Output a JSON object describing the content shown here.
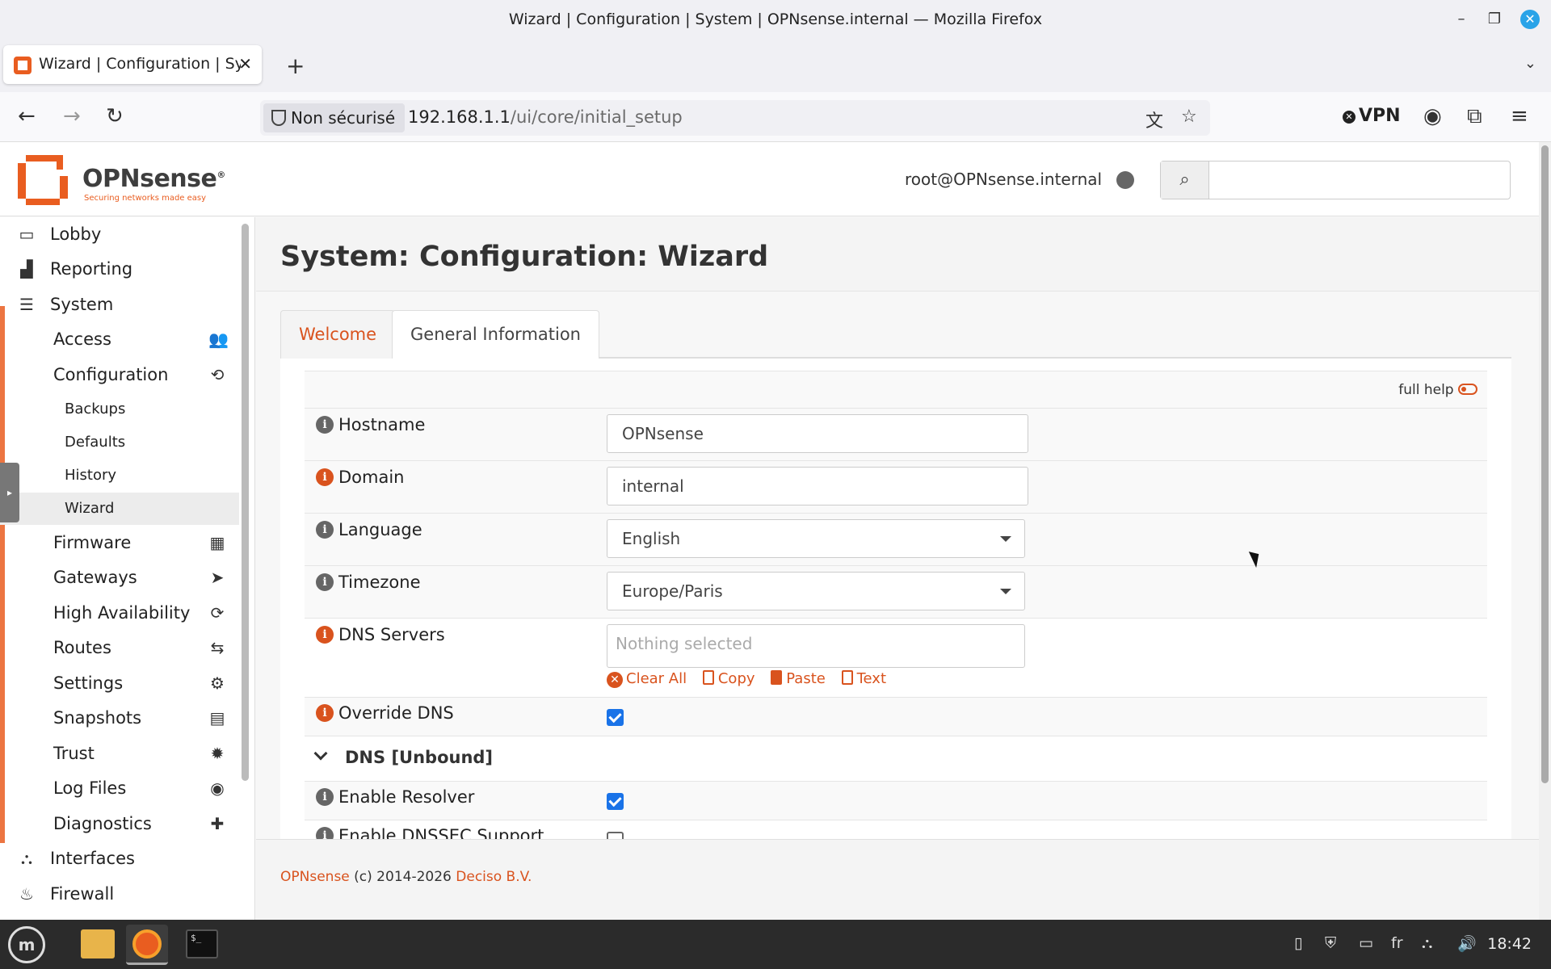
{
  "window": {
    "title": "Wizard | Configuration | System | OPNsense.internal — Mozilla Firefox",
    "minimize": "–",
    "maximize": "❐",
    "close": "✕"
  },
  "browser": {
    "tab_title": "Wizard | Configuration | System | OPNsense.internal",
    "tab_close": "✕",
    "new_tab": "+",
    "tab_list": "⌄",
    "back": "←",
    "forward": "→",
    "reload": "↻",
    "security_label": "Non sécurisé",
    "url_host": "192.168.1.1",
    "url_path": "/ui/core/initial_setup",
    "translate_icon": "文",
    "bookmark_icon": "☆",
    "vpn_label": "VPN",
    "account_icon": "◉",
    "extensions_icon": "⧉",
    "menu_icon": "≡"
  },
  "header": {
    "logo_text": "OPNsense",
    "logo_mark": "®",
    "logo_tagline": "Securing networks made easy",
    "user": "root@OPNsense.internal",
    "search_icon": "⌕",
    "search_value": ""
  },
  "sidebar": {
    "items": [
      {
        "label": "Lobby",
        "icon": "▭",
        "level": 0
      },
      {
        "label": "Reporting",
        "icon": "▟",
        "level": 0
      },
      {
        "label": "System",
        "icon": "☰",
        "level": 0
      },
      {
        "label": "Access",
        "icon": "👥",
        "level": 1
      },
      {
        "label": "Configuration",
        "icon": "⟲",
        "level": 1
      },
      {
        "label": "Backups",
        "level": 2
      },
      {
        "label": "Defaults",
        "level": 2
      },
      {
        "label": "History",
        "level": 2
      },
      {
        "label": "Wizard",
        "level": 2,
        "active": true
      },
      {
        "label": "Firmware",
        "icon": "▦",
        "level": 1
      },
      {
        "label": "Gateways",
        "icon": "➤",
        "level": 1
      },
      {
        "label": "High Availability",
        "icon": "⟳",
        "level": 1
      },
      {
        "label": "Routes",
        "icon": "⇆",
        "level": 1
      },
      {
        "label": "Settings",
        "icon": "⚙",
        "level": 1
      },
      {
        "label": "Snapshots",
        "icon": "▤",
        "level": 1
      },
      {
        "label": "Trust",
        "icon": "✹",
        "level": 1
      },
      {
        "label": "Log Files",
        "icon": "◉",
        "level": 1
      },
      {
        "label": "Diagnostics",
        "icon": "✚",
        "level": 1
      },
      {
        "label": "Interfaces",
        "icon": "⛬",
        "level": 0
      },
      {
        "label": "Firewall",
        "icon": "♨",
        "level": 0
      }
    ],
    "toggle": "▸"
  },
  "main": {
    "title": "System: Configuration: Wizard",
    "tabs": [
      {
        "label": "Welcome",
        "active": false
      },
      {
        "label": "General Information",
        "active": true
      }
    ],
    "full_help": "full help",
    "fields": {
      "hostname": {
        "label": "Hostname",
        "value": "OPNsense"
      },
      "domain": {
        "label": "Domain",
        "value": "internal"
      },
      "language": {
        "label": "Language",
        "value": "English"
      },
      "timezone": {
        "label": "Timezone",
        "value": "Europe/Paris"
      },
      "dns_servers": {
        "label": "DNS Servers",
        "placeholder": "Nothing selected"
      },
      "override_dns": {
        "label": "Override DNS",
        "checked": true
      },
      "enable_resolver": {
        "label": "Enable Resolver",
        "checked": true
      },
      "enable_dnssec": {
        "label": "Enable DNSSEC Support",
        "checked": false
      }
    },
    "token_actions": {
      "clear_all": "Clear All",
      "copy": "Copy",
      "paste": "Paste",
      "text": "Text"
    },
    "section_dns": "DNS [Unbound]"
  },
  "footer": {
    "brand": "OPNsense",
    "copyright": "(c) 2014-2026",
    "company": "Deciso B.V."
  },
  "taskbar": {
    "terminal_label": "$_",
    "keyboard_layout": "fr",
    "clock": "18:42"
  },
  "colors": {
    "accent": "#d9531e",
    "logo_orange": "#e95d20",
    "checkbox_blue": "#1a73e8"
  }
}
